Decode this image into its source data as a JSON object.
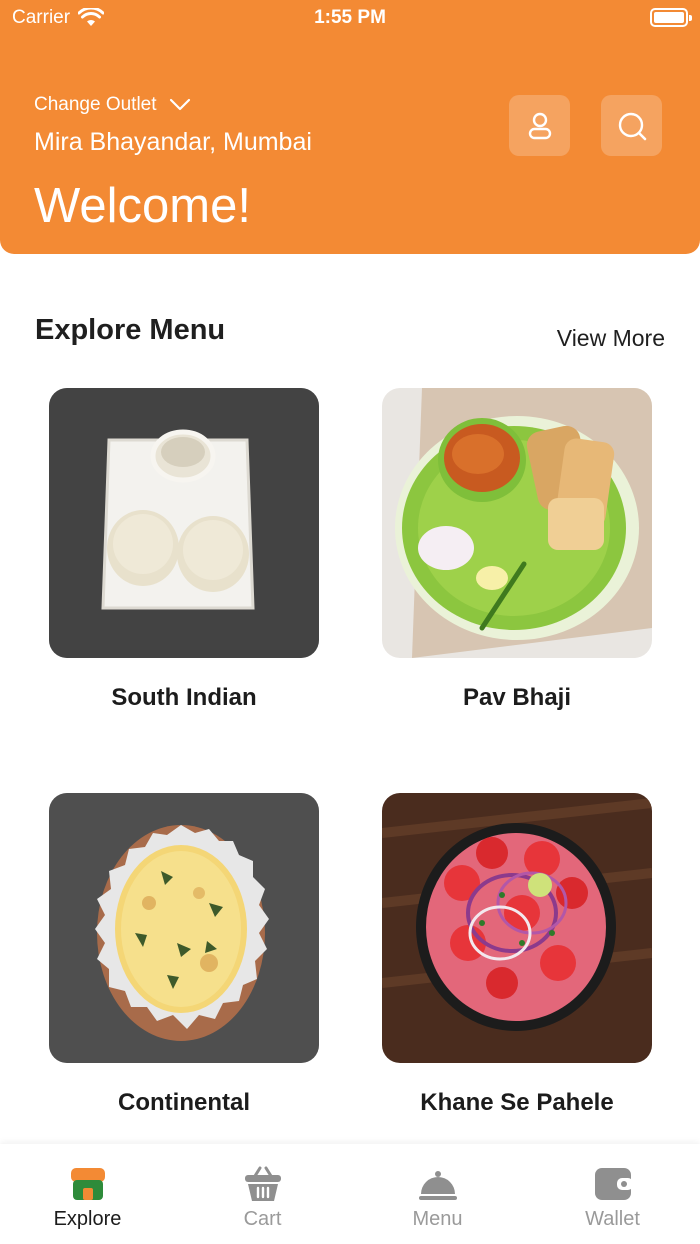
{
  "status_bar": {
    "carrier": "Carrier",
    "time": "1:55 PM"
  },
  "header": {
    "change_outlet_label": "Change Outlet",
    "location": "Mira Bhayandar, Mumbai",
    "welcome": "Welcome!",
    "accent_color": "#f38a34"
  },
  "section": {
    "title": "Explore Menu",
    "view_more": "View More"
  },
  "menu_items": [
    {
      "label": "South Indian",
      "image": "idli-sambar-plate-icon"
    },
    {
      "label": "Pav Bhaji",
      "image": "pav-bhaji-plate-icon"
    },
    {
      "label": "Continental",
      "image": "cheese-pizza-icon"
    },
    {
      "label": "Khane Se Pahele",
      "image": "salad-platter-icon"
    }
  ],
  "tabbar": {
    "tabs": [
      {
        "label": "Explore",
        "icon": "store-icon",
        "active": true
      },
      {
        "label": "Cart",
        "icon": "basket-icon",
        "active": false
      },
      {
        "label": "Menu",
        "icon": "cloche-icon",
        "active": false
      },
      {
        "label": "Wallet",
        "icon": "wallet-icon",
        "active": false
      }
    ]
  }
}
